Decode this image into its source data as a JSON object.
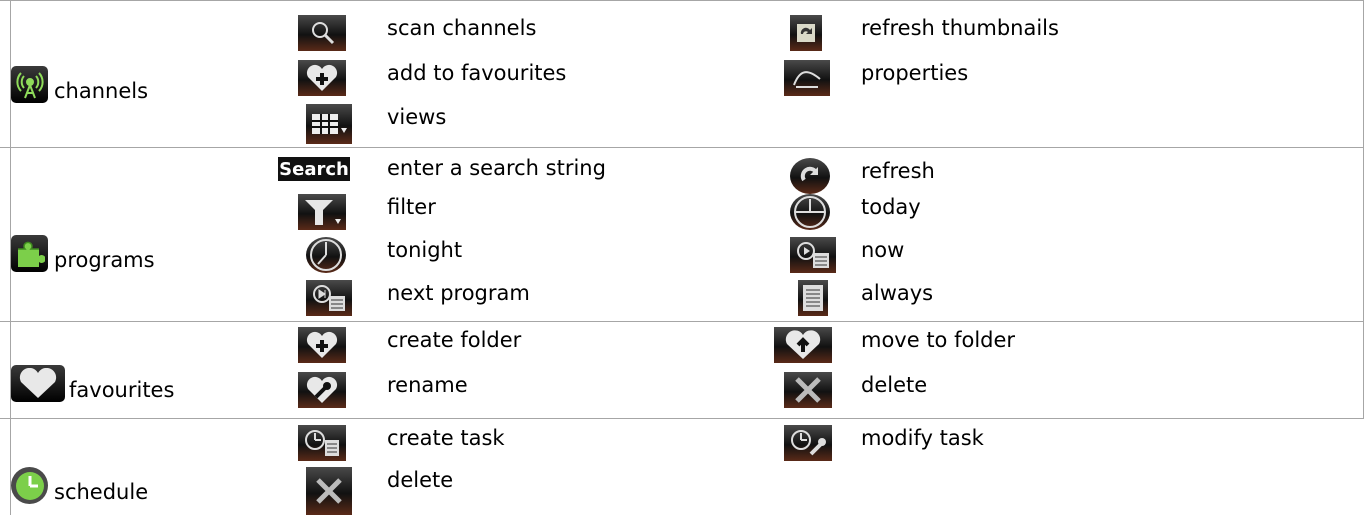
{
  "sections": [
    {
      "id": "channels",
      "label": "channels",
      "icon": "antenna-icon",
      "commands": [
        {
          "label": "scan channels",
          "icon": "scan-icon"
        },
        {
          "label": "refresh thumbnails",
          "icon": "refresh-thumbnails-icon"
        },
        {
          "label": "add to favourites",
          "icon": "heart-add-icon"
        },
        {
          "label": "properties",
          "icon": "properties-icon"
        },
        {
          "label": "views",
          "icon": "grid-view-icon"
        }
      ]
    },
    {
      "id": "programs",
      "label": "programs",
      "icon": "puzzle-icon",
      "commands": [
        {
          "label": "enter a search string",
          "icon": "search-icon",
          "icon_text": "Search"
        },
        {
          "label": "refresh",
          "icon": "refresh-icon"
        },
        {
          "label": "filter",
          "icon": "filter-icon"
        },
        {
          "label": "today",
          "icon": "clock-today-icon"
        },
        {
          "label": "tonight",
          "icon": "clock-tonight-icon"
        },
        {
          "label": "now",
          "icon": "now-icon"
        },
        {
          "label": "next program",
          "icon": "next-program-icon"
        },
        {
          "label": "always",
          "icon": "list-icon"
        }
      ]
    },
    {
      "id": "favourites",
      "label": "favourites",
      "icon": "heart-icon",
      "commands": [
        {
          "label": "create folder",
          "icon": "heart-add-icon"
        },
        {
          "label": "move to folder",
          "icon": "heart-up-icon"
        },
        {
          "label": "rename",
          "icon": "heart-wrench-icon"
        },
        {
          "label": "delete",
          "icon": "delete-icon"
        }
      ]
    },
    {
      "id": "schedule",
      "label": "schedule",
      "icon": "clock-icon",
      "commands": [
        {
          "label": "create task",
          "icon": "task-create-icon"
        },
        {
          "label": "modify task",
          "icon": "task-modify-icon"
        },
        {
          "label": "delete",
          "icon": "delete-icon"
        }
      ]
    }
  ]
}
